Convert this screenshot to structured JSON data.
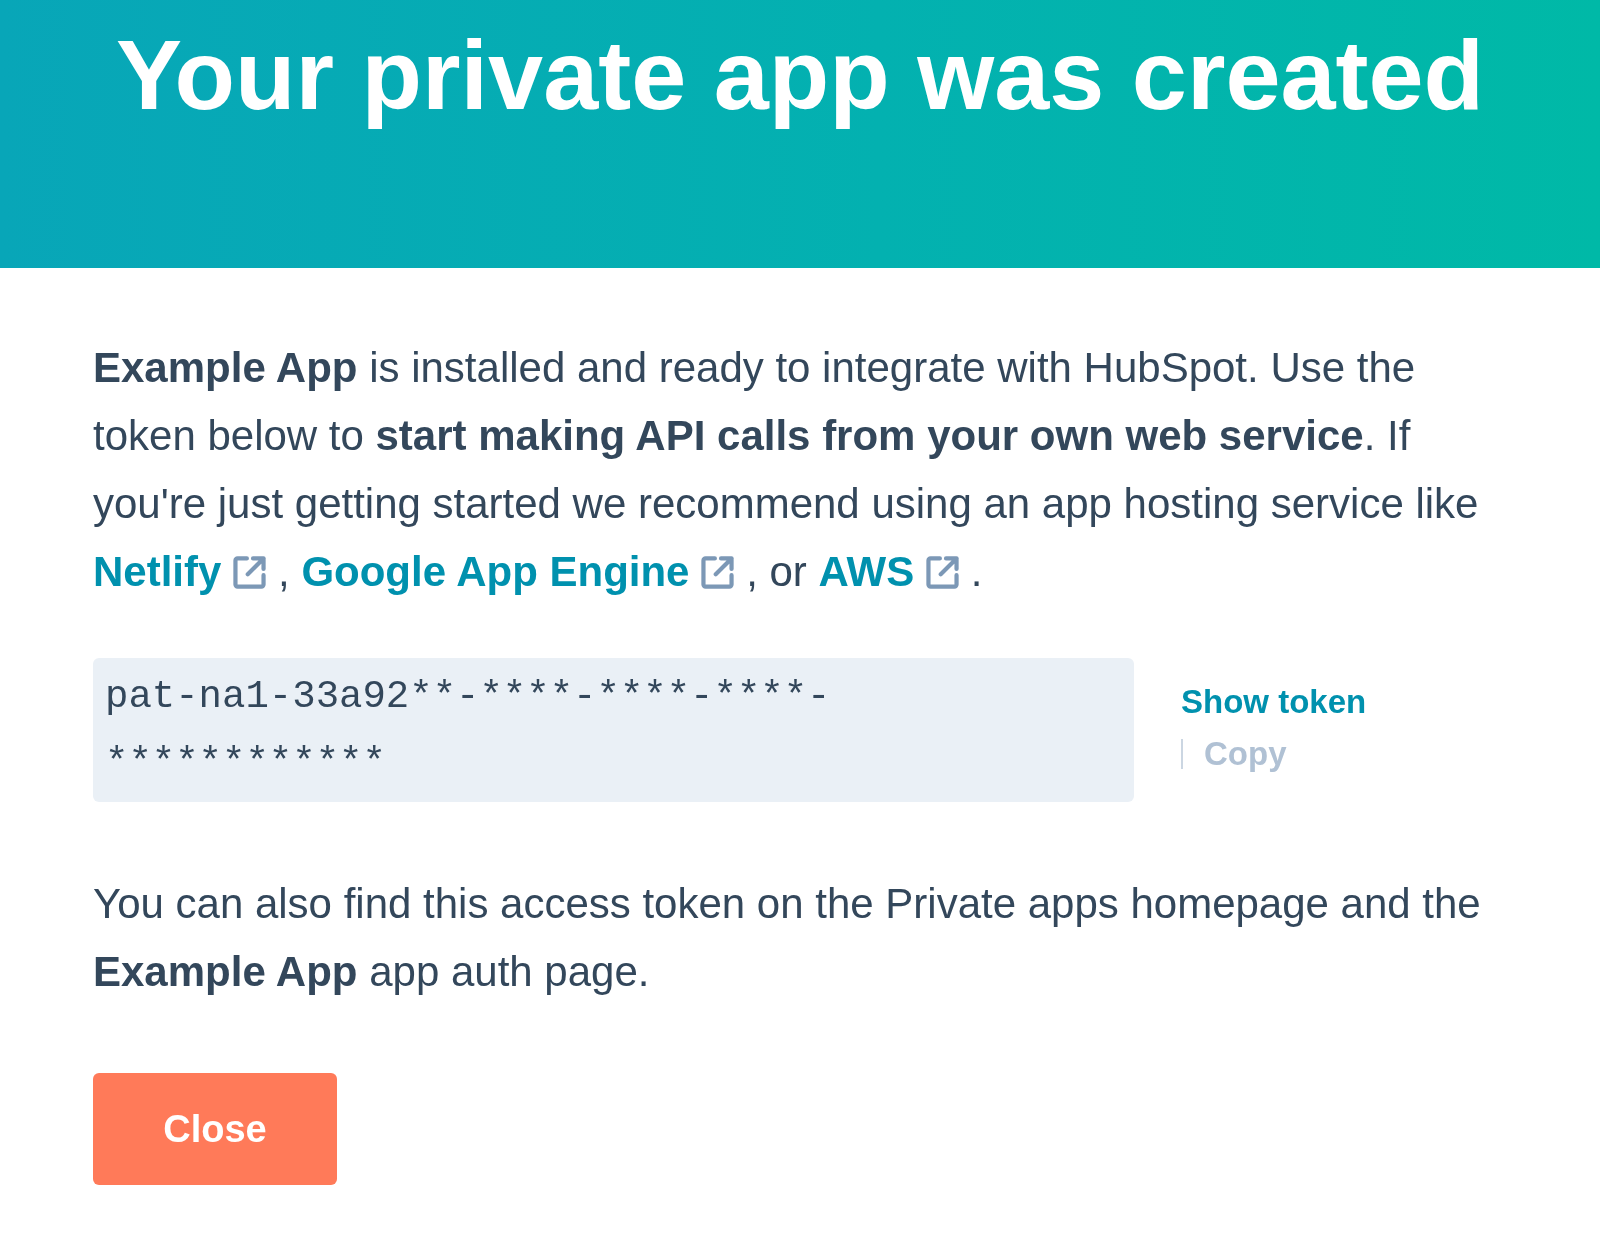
{
  "header": {
    "title": "Your private app was created"
  },
  "intro": {
    "segments": [
      {
        "kind": "text",
        "text": "**Example App** is installed and ready to integrate with HubSpot. Use the token below to **start making API calls from your own web service**. If you're just getting started we recommend using an app hosting service like"
      },
      {
        "kind": "link",
        "text": "Netlify"
      },
      {
        "kind": "text",
        "text": ","
      },
      {
        "kind": "link",
        "text": "Google App Engine"
      },
      {
        "kind": "text",
        "text": ", or"
      },
      {
        "kind": "link",
        "text": "AWS"
      },
      {
        "kind": "text",
        "text": "."
      }
    ]
  },
  "token": {
    "value": "pat-na1-33a92**-****-****-****-************"
  },
  "actions": [
    {
      "label": "Show token",
      "disabled": false
    },
    {
      "label": "Copy",
      "disabled": true
    }
  ],
  "outro": {
    "text": "You can also find this access token on the Private apps homepage and the **Example App** app auth page."
  },
  "close_button": {
    "label": "Close"
  }
}
